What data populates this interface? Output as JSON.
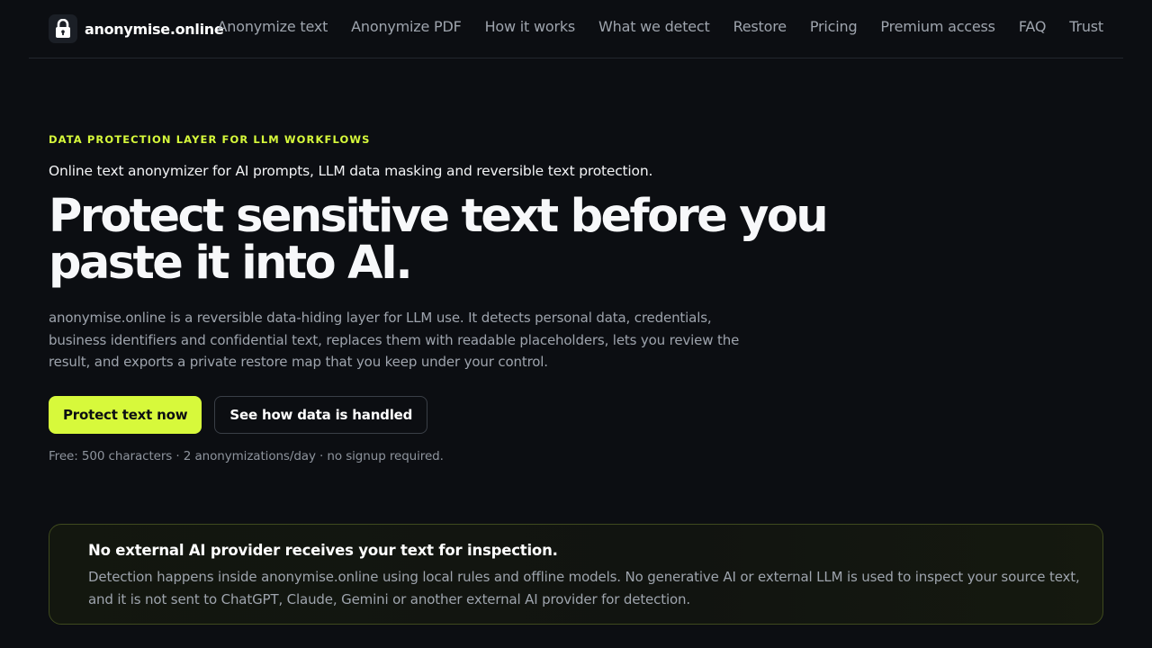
{
  "brand": {
    "name": "anonymise.online",
    "icon": "lock-icon"
  },
  "nav": {
    "items": [
      {
        "label": "Anonymize text"
      },
      {
        "label": "Anonymize PDF"
      },
      {
        "label": "How it works"
      },
      {
        "label": "What we detect"
      },
      {
        "label": "Restore"
      },
      {
        "label": "Pricing"
      },
      {
        "label": "Premium access"
      },
      {
        "label": "FAQ"
      },
      {
        "label": "Trust"
      }
    ]
  },
  "hero": {
    "eyebrow": "DATA PROTECTION LAYER FOR LLM WORKFLOWS",
    "subline": "Online text anonymizer for AI prompts, LLM data masking and reversible text protection.",
    "headline": "Protect sensitive text before you paste it into AI.",
    "description": "anonymise.online is a reversible data-hiding layer for LLM use. It detects personal data, credentials, business identifiers and confidential text, replaces them with readable placeholders, lets you review the result, and exports a private restore map that you keep under your control.",
    "primary_cta": "Protect text now",
    "secondary_cta": "See how data is handled",
    "free_note": "Free: 500 characters · 2 anonymizations/day · no signup required."
  },
  "notice": {
    "title": "No external AI provider receives your text for inspection.",
    "text": "Detection happens inside anonymise.online using local rules and offline models. No generative AI or external LLM is used to inspect your source text, and it is not sent to ChatGPT, Claude, Gemini or another external AI provider for detection."
  },
  "colors": {
    "background": "#0c0e12",
    "accent": "#d7f93b",
    "muted_text": "#9ea4ad",
    "notice_border": "#3f4a1e"
  }
}
